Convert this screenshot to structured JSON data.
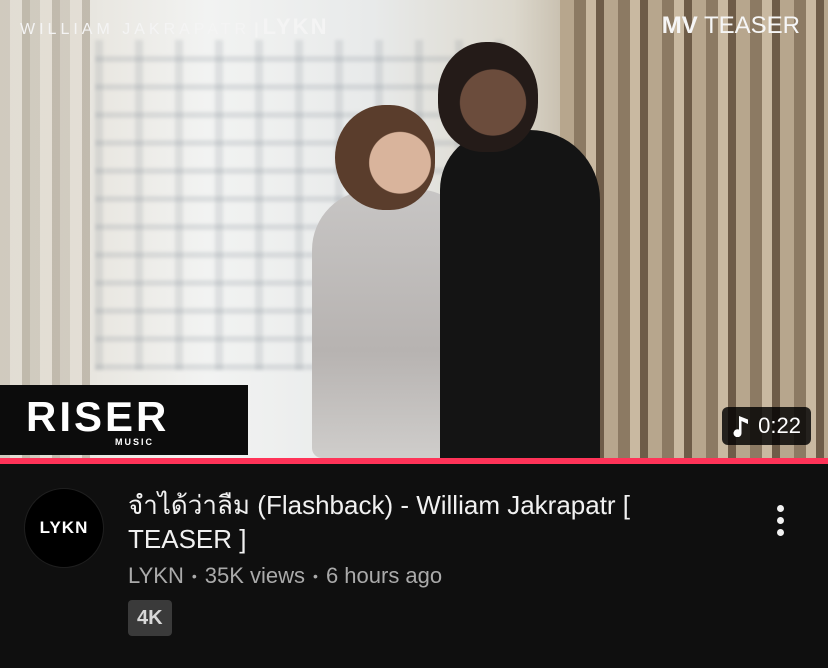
{
  "thumbnail": {
    "artist_text": "WILLIAM JAKRAPATR",
    "separator": "|",
    "brand_text": "LYKN",
    "corner_bold": "MV",
    "corner_rest": " TEASER",
    "label_name": "RISER",
    "label_sub": "MUSIC",
    "duration": "0:22",
    "duration_icon": "music-note-icon"
  },
  "progress": {
    "watched_fraction": 1.0,
    "color": "#ff3358"
  },
  "video": {
    "title": "จำได้ว่าลืม (Flashback) - William Jakrapatr [ TEASER ]",
    "channel": "LYKN",
    "views": "35K views",
    "age": "6 hours ago",
    "quality_badge": "4K",
    "avatar_text": "LYKN"
  },
  "colors": {
    "background": "#0f0f0f",
    "meta_text": "#aaaaaa",
    "badge_bg": "#3a3a3a"
  }
}
